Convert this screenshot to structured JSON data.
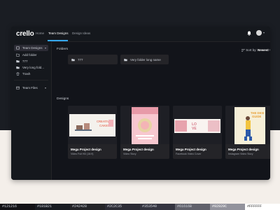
{
  "app": {
    "logo": "crello",
    "nav": [
      "Home",
      "Team Designs",
      "Design Ideas"
    ]
  },
  "sidebar": {
    "items": [
      {
        "label": "Team Designs",
        "icon": "team-icon"
      },
      {
        "label": "Add folder",
        "icon": "add-folder-icon"
      },
      {
        "label": "777",
        "icon": "folder-icon"
      },
      {
        "label": "Very long fold...",
        "icon": "folder-icon"
      },
      {
        "label": "Trash",
        "icon": "trash-icon"
      },
      {
        "label": "Team Files",
        "icon": "files-icon"
      }
    ]
  },
  "main": {
    "folders_title": "Folders",
    "sort_label": "Sort by:",
    "sort_value": "Newest",
    "folders": [
      {
        "label": "777"
      },
      {
        "label": "Very folder long name"
      }
    ],
    "designs_title": "Designs",
    "designs": [
      {
        "title": "Mega Project design",
        "sub": "Video Full HD (16:9)",
        "thumb": "CREATIVE CAKES"
      },
      {
        "title": "Mega Project design",
        "sub": "Video Story",
        "thumb": ""
      },
      {
        "title": "Mega Project design",
        "sub": "Facebook Video Cover",
        "thumb": "LOVE"
      },
      {
        "title": "Mega Project design",
        "sub": "Instagram Video Story",
        "thumb": "THE DESIGN GUIDE"
      }
    ]
  },
  "palette": [
    "#12121​6",
    "#181B21",
    "#242428",
    "#2C2C35",
    "#353540",
    "#61616B",
    "#92929C",
    "#FFFFFF"
  ],
  "colors": {
    "accent": "#35a7ff",
    "background": "#12121a",
    "surface": "#242428"
  }
}
